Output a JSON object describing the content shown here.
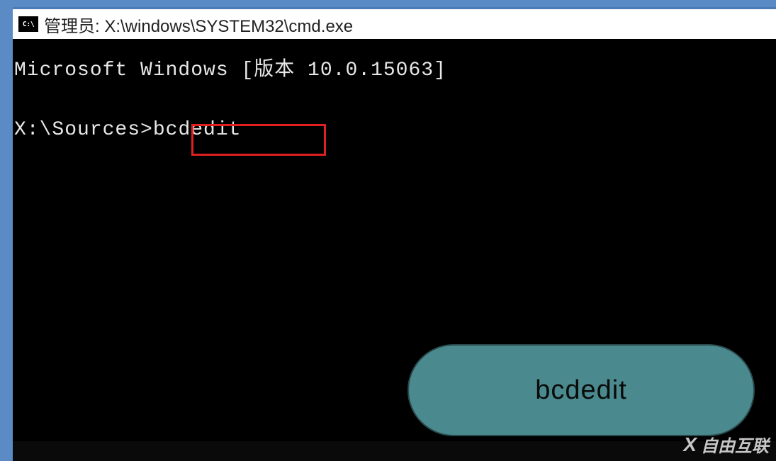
{
  "titlebar": {
    "icon_label": "C:\\",
    "text": "管理员: X:\\windows\\SYSTEM32\\cmd.exe"
  },
  "console": {
    "line1": "Microsoft Windows [版本 10.0.15063]",
    "prompt": "X:\\Sources>",
    "command": "bcdedit"
  },
  "annotation": {
    "label": "bcdedit"
  },
  "watermark": {
    "text": "自由互联"
  }
}
